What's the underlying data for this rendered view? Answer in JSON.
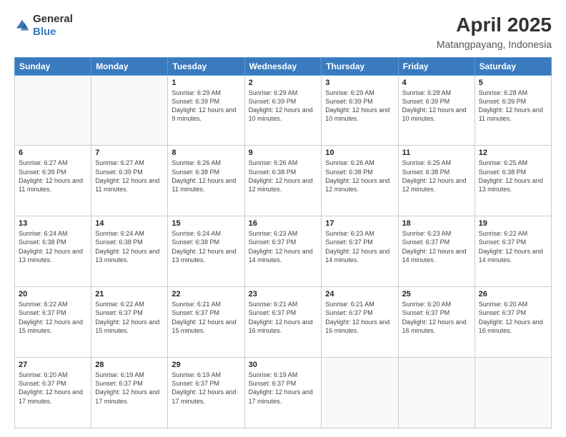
{
  "header": {
    "logo_general": "General",
    "logo_blue": "Blue",
    "title": "April 2025",
    "subtitle": "Matangpayang, Indonesia"
  },
  "days_of_week": [
    "Sunday",
    "Monday",
    "Tuesday",
    "Wednesday",
    "Thursday",
    "Friday",
    "Saturday"
  ],
  "weeks": [
    [
      {
        "day": "",
        "info": ""
      },
      {
        "day": "",
        "info": ""
      },
      {
        "day": "1",
        "info": "Sunrise: 6:29 AM\nSunset: 6:39 PM\nDaylight: 12 hours and 9 minutes."
      },
      {
        "day": "2",
        "info": "Sunrise: 6:29 AM\nSunset: 6:39 PM\nDaylight: 12 hours and 10 minutes."
      },
      {
        "day": "3",
        "info": "Sunrise: 6:29 AM\nSunset: 6:39 PM\nDaylight: 12 hours and 10 minutes."
      },
      {
        "day": "4",
        "info": "Sunrise: 6:28 AM\nSunset: 6:39 PM\nDaylight: 12 hours and 10 minutes."
      },
      {
        "day": "5",
        "info": "Sunrise: 6:28 AM\nSunset: 6:39 PM\nDaylight: 12 hours and 11 minutes."
      }
    ],
    [
      {
        "day": "6",
        "info": "Sunrise: 6:27 AM\nSunset: 6:39 PM\nDaylight: 12 hours and 11 minutes."
      },
      {
        "day": "7",
        "info": "Sunrise: 6:27 AM\nSunset: 6:39 PM\nDaylight: 12 hours and 11 minutes."
      },
      {
        "day": "8",
        "info": "Sunrise: 6:26 AM\nSunset: 6:38 PM\nDaylight: 12 hours and 11 minutes."
      },
      {
        "day": "9",
        "info": "Sunrise: 6:26 AM\nSunset: 6:38 PM\nDaylight: 12 hours and 12 minutes."
      },
      {
        "day": "10",
        "info": "Sunrise: 6:26 AM\nSunset: 6:38 PM\nDaylight: 12 hours and 12 minutes."
      },
      {
        "day": "11",
        "info": "Sunrise: 6:25 AM\nSunset: 6:38 PM\nDaylight: 12 hours and 12 minutes."
      },
      {
        "day": "12",
        "info": "Sunrise: 6:25 AM\nSunset: 6:38 PM\nDaylight: 12 hours and 13 minutes."
      }
    ],
    [
      {
        "day": "13",
        "info": "Sunrise: 6:24 AM\nSunset: 6:38 PM\nDaylight: 12 hours and 13 minutes."
      },
      {
        "day": "14",
        "info": "Sunrise: 6:24 AM\nSunset: 6:38 PM\nDaylight: 12 hours and 13 minutes."
      },
      {
        "day": "15",
        "info": "Sunrise: 6:24 AM\nSunset: 6:38 PM\nDaylight: 12 hours and 13 minutes."
      },
      {
        "day": "16",
        "info": "Sunrise: 6:23 AM\nSunset: 6:37 PM\nDaylight: 12 hours and 14 minutes."
      },
      {
        "day": "17",
        "info": "Sunrise: 6:23 AM\nSunset: 6:37 PM\nDaylight: 12 hours and 14 minutes."
      },
      {
        "day": "18",
        "info": "Sunrise: 6:23 AM\nSunset: 6:37 PM\nDaylight: 12 hours and 14 minutes."
      },
      {
        "day": "19",
        "info": "Sunrise: 6:22 AM\nSunset: 6:37 PM\nDaylight: 12 hours and 14 minutes."
      }
    ],
    [
      {
        "day": "20",
        "info": "Sunrise: 6:22 AM\nSunset: 6:37 PM\nDaylight: 12 hours and 15 minutes."
      },
      {
        "day": "21",
        "info": "Sunrise: 6:22 AM\nSunset: 6:37 PM\nDaylight: 12 hours and 15 minutes."
      },
      {
        "day": "22",
        "info": "Sunrise: 6:21 AM\nSunset: 6:37 PM\nDaylight: 12 hours and 15 minutes."
      },
      {
        "day": "23",
        "info": "Sunrise: 6:21 AM\nSunset: 6:37 PM\nDaylight: 12 hours and 16 minutes."
      },
      {
        "day": "24",
        "info": "Sunrise: 6:21 AM\nSunset: 6:37 PM\nDaylight: 12 hours and 16 minutes."
      },
      {
        "day": "25",
        "info": "Sunrise: 6:20 AM\nSunset: 6:37 PM\nDaylight: 12 hours and 16 minutes."
      },
      {
        "day": "26",
        "info": "Sunrise: 6:20 AM\nSunset: 6:37 PM\nDaylight: 12 hours and 16 minutes."
      }
    ],
    [
      {
        "day": "27",
        "info": "Sunrise: 6:20 AM\nSunset: 6:37 PM\nDaylight: 12 hours and 17 minutes."
      },
      {
        "day": "28",
        "info": "Sunrise: 6:19 AM\nSunset: 6:37 PM\nDaylight: 12 hours and 17 minutes."
      },
      {
        "day": "29",
        "info": "Sunrise: 6:19 AM\nSunset: 6:37 PM\nDaylight: 12 hours and 17 minutes."
      },
      {
        "day": "30",
        "info": "Sunrise: 6:19 AM\nSunset: 6:37 PM\nDaylight: 12 hours and 17 minutes."
      },
      {
        "day": "",
        "info": ""
      },
      {
        "day": "",
        "info": ""
      },
      {
        "day": "",
        "info": ""
      }
    ]
  ]
}
